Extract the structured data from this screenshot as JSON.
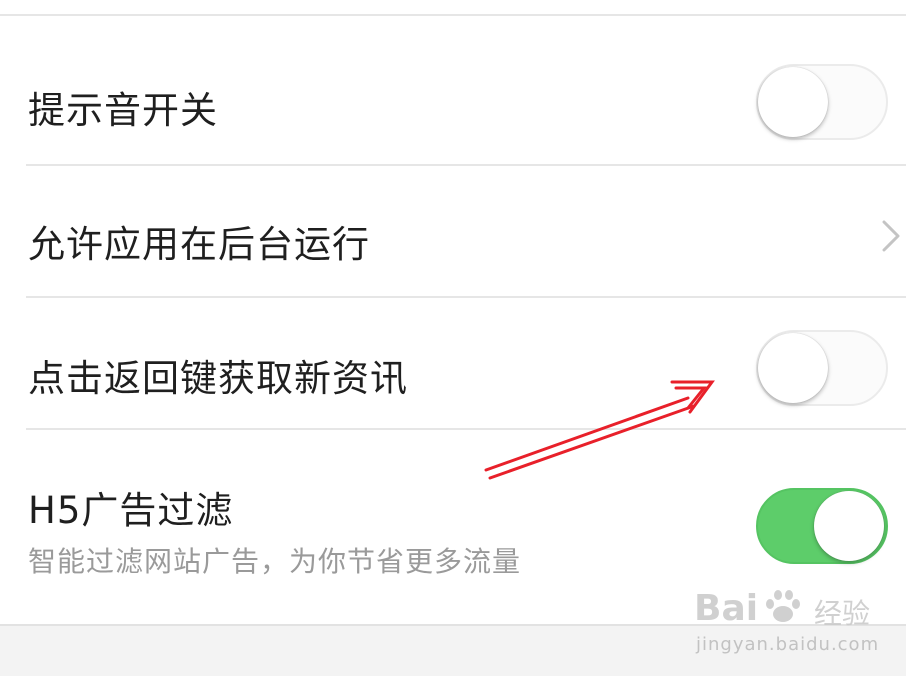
{
  "settings": {
    "items": [
      {
        "label": "提示音开关",
        "control": "toggle",
        "state": "off"
      },
      {
        "label": "允许应用在后台运行",
        "control": "chevron"
      },
      {
        "label": "点击返回键获取新资讯",
        "control": "toggle",
        "state": "off"
      },
      {
        "label": "H5广告过滤",
        "sublabel": "智能过滤网站广告，为你节省更多流量",
        "control": "toggle",
        "state": "on"
      }
    ]
  },
  "colors": {
    "toggle_on": "#5dcd6a",
    "toggle_off": "#fbfbfb",
    "annotation_arrow": "#e8202a"
  },
  "annotation": {
    "icon": "red-arrow-icon"
  },
  "watermark": {
    "logo": "Bai",
    "logo_icon": "paw-icon",
    "label": "经验",
    "url": "jingyan.baidu.com"
  }
}
